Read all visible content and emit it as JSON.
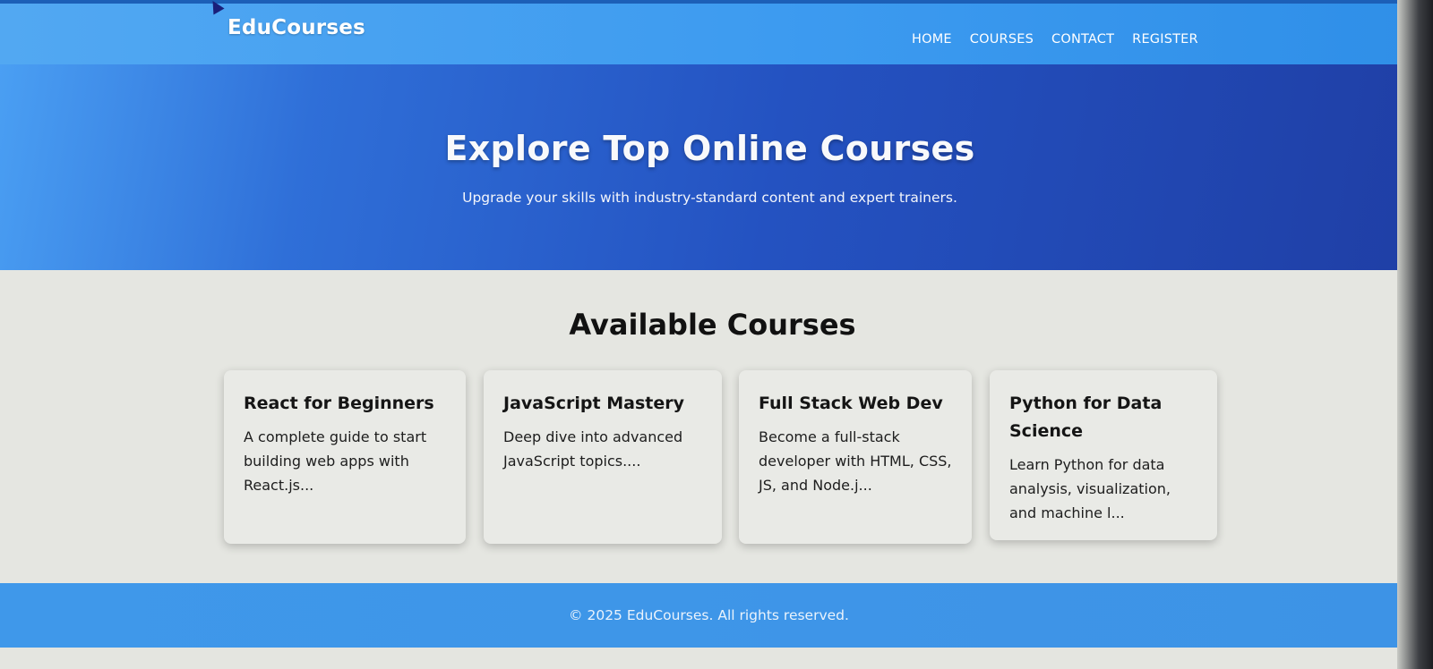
{
  "navbar": {
    "brand": "EduCourses",
    "links": [
      {
        "label": "HOME"
      },
      {
        "label": "COURSES"
      },
      {
        "label": "CONTACT"
      },
      {
        "label": "REGISTER"
      }
    ]
  },
  "hero": {
    "title": "Explore Top Online Courses",
    "subtitle": "Upgrade your skills with industry-standard content and expert trainers."
  },
  "courses": {
    "heading": "Available Courses",
    "items": [
      {
        "title": "React for Beginners",
        "description": "A complete guide to start building web apps with React.js..."
      },
      {
        "title": "JavaScript Mastery",
        "description": "Deep dive into advanced JavaScript topics...."
      },
      {
        "title": "Full Stack Web Dev",
        "description": "Become a full-stack developer with HTML, CSS, JS, and Node.j..."
      },
      {
        "title": "Python for Data Science",
        "description": "Learn Python for data analysis, visualization, and machine l..."
      }
    ]
  },
  "footer": {
    "text": "© 2025 EduCourses. All rights reserved."
  },
  "colors": {
    "navbar": "#3d9bf0",
    "hero": "#2452c1",
    "footer": "#3d93e6",
    "background": "#e5e6e1"
  }
}
